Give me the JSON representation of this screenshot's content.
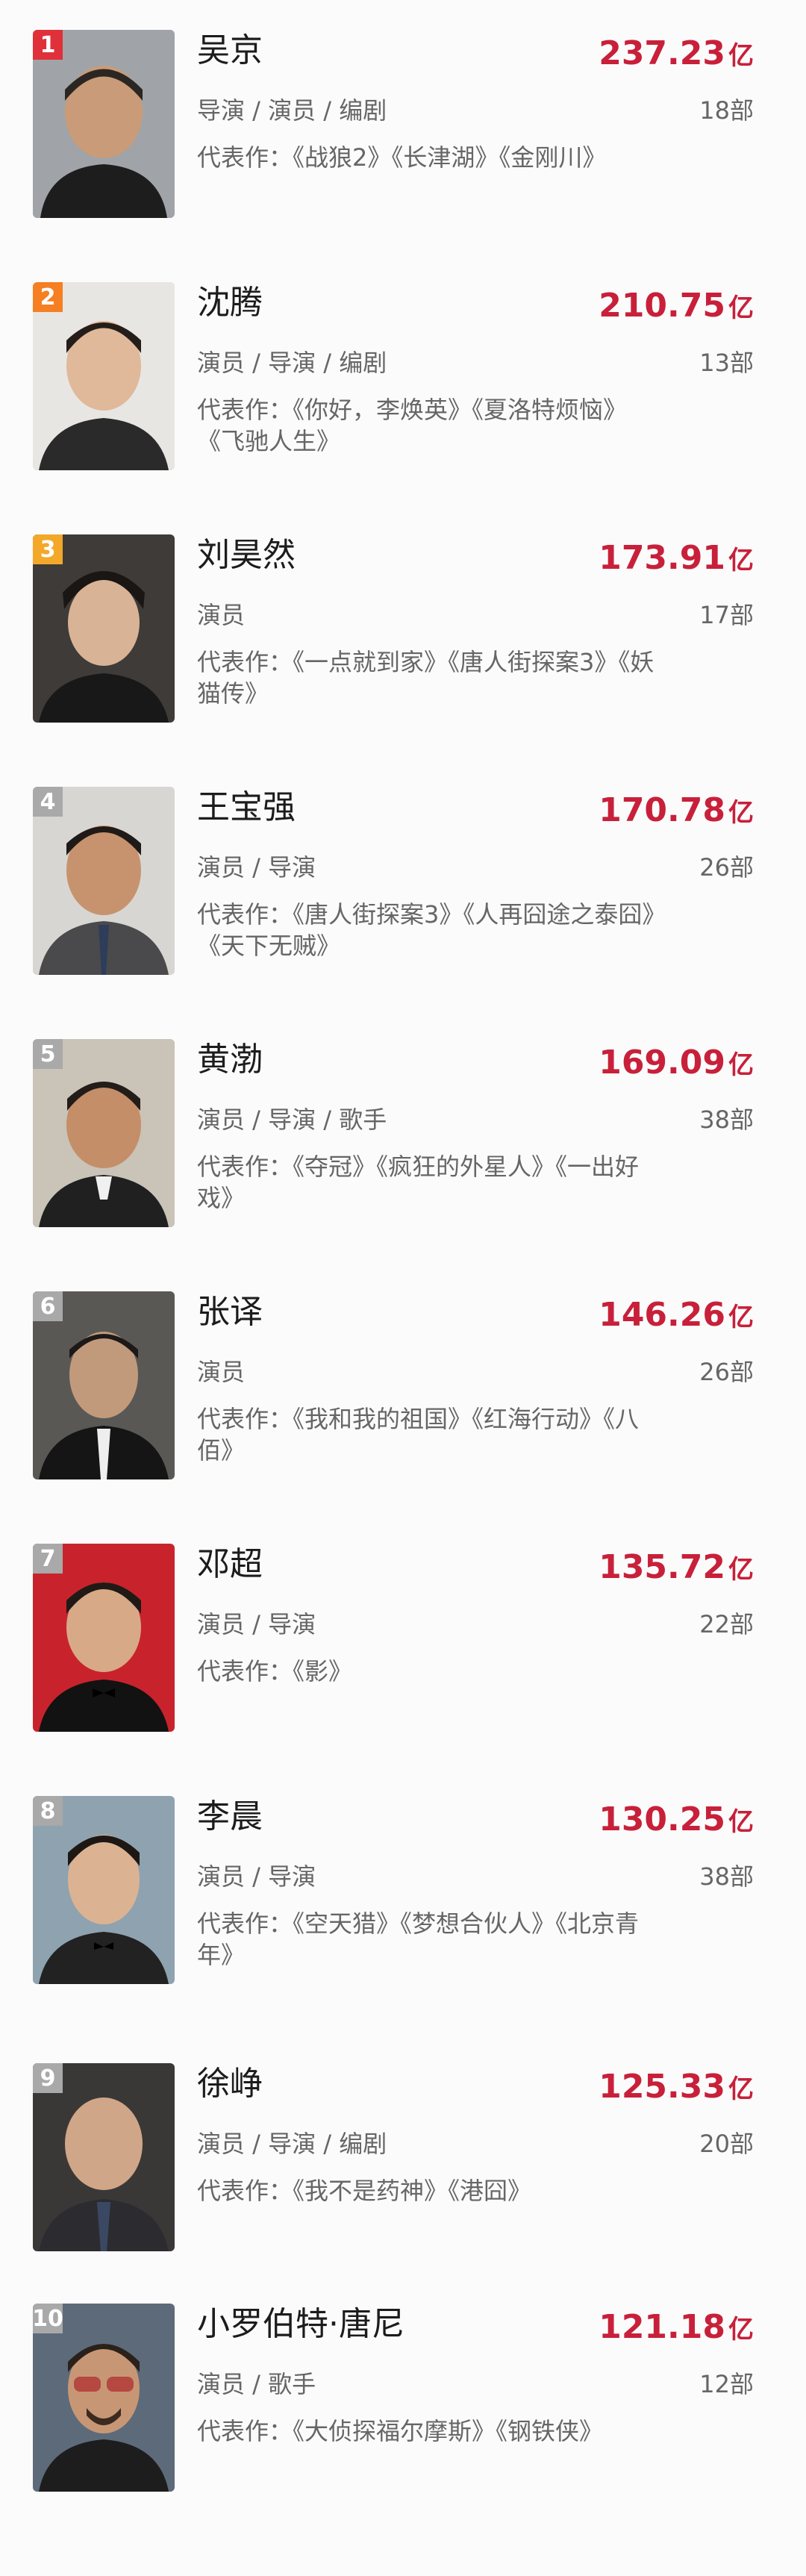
{
  "ranking": [
    {
      "rank": "1",
      "name": "吴京",
      "box_office": "237.23",
      "unit": "亿",
      "roles": "导演 / 演员 / 编剧",
      "film_count": "18部",
      "works": "代表作：《战狼2》《长津湖》《金刚川》"
    },
    {
      "rank": "2",
      "name": "沈腾",
      "box_office": "210.75",
      "unit": "亿",
      "roles": "演员 / 导演 / 编剧",
      "film_count": "13部",
      "works": "代表作：《你好，李焕英》《夏洛特烦恼》《飞驰人生》"
    },
    {
      "rank": "3",
      "name": "刘昊然",
      "box_office": "173.91",
      "unit": "亿",
      "roles": "演员",
      "film_count": "17部",
      "works": "代表作：《一点就到家》《唐人街探案3》《妖猫传》"
    },
    {
      "rank": "4",
      "name": "王宝强",
      "box_office": "170.78",
      "unit": "亿",
      "roles": "演员 / 导演",
      "film_count": "26部",
      "works": "代表作：《唐人街探案3》《人再囧途之泰囧》《天下无贼》"
    },
    {
      "rank": "5",
      "name": "黄渤",
      "box_office": "169.09",
      "unit": "亿",
      "roles": "演员 / 导演 / 歌手",
      "film_count": "38部",
      "works": "代表作：《夺冠》《疯狂的外星人》《一出好戏》"
    },
    {
      "rank": "6",
      "name": "张译",
      "box_office": "146.26",
      "unit": "亿",
      "roles": "演员",
      "film_count": "26部",
      "works": "代表作：《我和我的祖国》《红海行动》《八佰》"
    },
    {
      "rank": "7",
      "name": "邓超",
      "box_office": "135.72",
      "unit": "亿",
      "roles": "演员 / 导演",
      "film_count": "22部",
      "works": "代表作：《影》"
    },
    {
      "rank": "8",
      "name": "李晨",
      "box_office": "130.25",
      "unit": "亿",
      "roles": "演员 / 导演",
      "film_count": "38部",
      "works": "代表作：《空天猎》《梦想合伙人》《北京青年》"
    },
    {
      "rank": "9",
      "name": "徐峥",
      "box_office": "125.33",
      "unit": "亿",
      "roles": "演员 / 导演 / 编剧",
      "film_count": "20部",
      "works": "代表作：《我不是药神》《港囧》"
    },
    {
      "rank": "10",
      "name": "小罗伯特·唐尼",
      "box_office": "121.18",
      "unit": "亿",
      "roles": "演员 / 歌手",
      "film_count": "12部",
      "works": "代表作：《大侦探福尔摩斯》《钢铁侠》"
    }
  ],
  "colors": {
    "accent_red": "#c8203a",
    "rank1": "#e0303a",
    "rank2": "#f57f22",
    "rank3": "#f3a82a",
    "rank_other": "#a9a9a9"
  }
}
